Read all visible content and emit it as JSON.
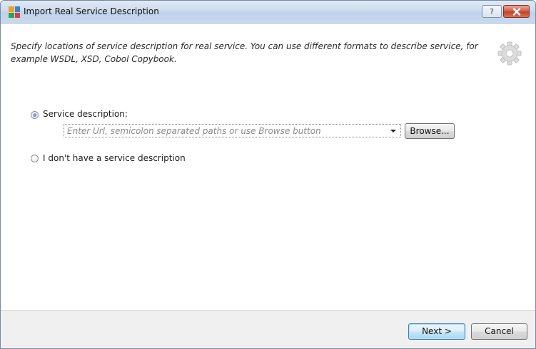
{
  "window": {
    "title": "Import Real Service Description",
    "help_glyph": "?",
    "close_icon": "close-icon"
  },
  "header": {
    "description": "Specify locations of service description for real service. You can use different formats to describe service, for example WSDL, XSD, Cobol Copybook.",
    "icon": "gear-icon"
  },
  "options": {
    "service_description": {
      "label": "Service description:",
      "selected": true
    },
    "location": {
      "value": "",
      "placeholder": "Enter Url, semicolon separated paths or use Browse button"
    },
    "browse_label": "Browse...",
    "no_description": {
      "label": "I don't have a service description",
      "selected": false
    }
  },
  "footer": {
    "next_label": "Next >",
    "cancel_label": "Cancel"
  }
}
